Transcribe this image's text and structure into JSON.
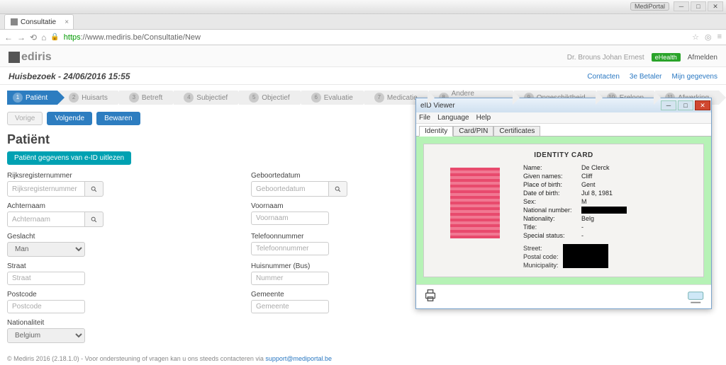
{
  "titlebar": {
    "text": "Consultatie"
  },
  "mediportal_badge": "MediPortal",
  "tabs": [
    {
      "label": "Consultatie"
    }
  ],
  "address": {
    "secure": "https",
    "host": "://www.mediris.be",
    "path": "/Consultatie/New"
  },
  "brand": "ediris",
  "user": {
    "name": "Dr. Brouns Johan Ernest",
    "ehealth": "eHealth",
    "logout": "Afmelden"
  },
  "visit": {
    "title": "Huisbezoek - 24/06/2016 15:55"
  },
  "toplinks": [
    "Contacten",
    "3e Betaler",
    "Mijn gegevens"
  ],
  "steps": [
    {
      "n": "1",
      "l": "Patiënt",
      "active": true
    },
    {
      "n": "2",
      "l": "Huisarts"
    },
    {
      "n": "3",
      "l": "Betreft"
    },
    {
      "n": "4",
      "l": "Subjectief"
    },
    {
      "n": "5",
      "l": "Objectief"
    },
    {
      "n": "6",
      "l": "Evaluatie"
    },
    {
      "n": "7",
      "l": "Medicatie"
    },
    {
      "n": "8",
      "l": "Andere behandeling"
    },
    {
      "n": "9",
      "l": "Ongeschiktheid"
    },
    {
      "n": "10",
      "l": "Ereloon"
    },
    {
      "n": "11",
      "l": "Afwerking"
    }
  ],
  "actions": {
    "prev": "Vorige",
    "next": "Volgende",
    "save": "Bewaren"
  },
  "page_title": "Patiënt",
  "eid_button": "Patiënt gegevens van e-ID uitlezen",
  "form": {
    "rijks": {
      "label": "Rijksregisternummer",
      "ph": "Rijksregisternummer"
    },
    "geboorte": {
      "label": "Geboortedatum",
      "ph": "Geboortedatum"
    },
    "achternaam": {
      "label": "Achternaam",
      "ph": "Achternaam"
    },
    "voornaam": {
      "label": "Voornaam",
      "ph": "Voornaam"
    },
    "geslacht": {
      "label": "Geslacht",
      "value": "Man"
    },
    "tel": {
      "label": "Telefoonnummer",
      "ph": "Telefoonnummer"
    },
    "straat": {
      "label": "Straat",
      "ph": "Straat"
    },
    "huis": {
      "label": "Huisnummer (Bus)",
      "ph": "Nummer"
    },
    "postcode": {
      "label": "Postcode",
      "ph": "Postcode"
    },
    "gemeente": {
      "label": "Gemeente",
      "ph": "Gemeente"
    },
    "nationaliteit": {
      "label": "Nationaliteit",
      "value": "Belgium"
    }
  },
  "footer": {
    "text": "© Mediris 2016 (2.18.1.0) - Voor ondersteuning of vragen kan u ons steeds contacteren via ",
    "link": "support@mediportal.be"
  },
  "eid": {
    "title": "eID Viewer",
    "menu": [
      "File",
      "Language",
      "Help"
    ],
    "tabs": [
      "Identity",
      "Card/PIN",
      "Certificates"
    ],
    "card_title": "IDENTITY CARD",
    "fields": [
      {
        "k": "Name:",
        "v": "De Clerck"
      },
      {
        "k": "Given names:",
        "v": "Cliff"
      },
      {
        "k": "Place of birth:",
        "v": "Gent"
      },
      {
        "k": "Date of birth:",
        "v": "Jul 8, 1981"
      },
      {
        "k": "Sex:",
        "v": "M"
      },
      {
        "k": "National number:",
        "v": "",
        "redact": true
      },
      {
        "k": "Nationality:",
        "v": "Belg"
      },
      {
        "k": "Title:",
        "v": "-"
      },
      {
        "k": "Special status:",
        "v": "-"
      }
    ],
    "addr_labels": [
      "Street:",
      "Postal code:",
      "Municipality:"
    ]
  }
}
